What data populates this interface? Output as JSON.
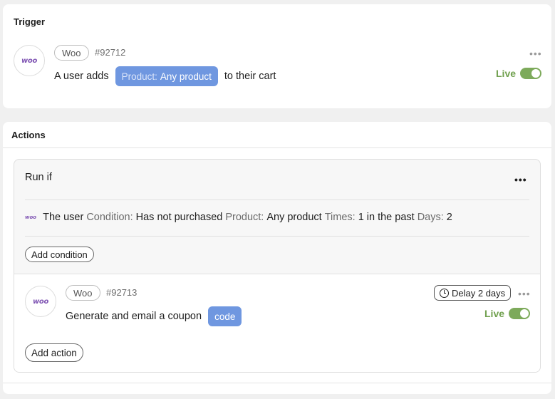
{
  "trigger": {
    "title": "Trigger",
    "logo_text": "woo",
    "integration_pill": "Woo",
    "id": "#92712",
    "sentence_prefix": "A user adds",
    "tag_key": "Product:",
    "tag_value": "Any product",
    "sentence_suffix": "to their cart",
    "menu": "•••",
    "status": "Live"
  },
  "actions": {
    "title": "Actions",
    "run_if": {
      "title": "Run if",
      "menu": "•••",
      "condition": {
        "logo_text": "woo",
        "subject": "The user",
        "condition_key": "Condition:",
        "condition_value": "Has not",
        "verb": "purchased",
        "product_key": "Product:",
        "product_value": "Any product",
        "times_key": "Times:",
        "times_value": "1 in the past",
        "days_key": "Days:",
        "days_value": "2"
      },
      "add_condition_label": "Add condition"
    },
    "action": {
      "logo_text": "woo",
      "integration_pill": "Woo",
      "id": "#92713",
      "sentence": "Generate and email a coupon",
      "tag": "code",
      "delay_label": "Delay 2 days",
      "menu": "•••",
      "status": "Live"
    },
    "add_action_label": "Add action"
  },
  "colors": {
    "accent_tag": "#6f97e0",
    "live_green": "#71a14f",
    "woo_purple": "#7f54b3"
  }
}
